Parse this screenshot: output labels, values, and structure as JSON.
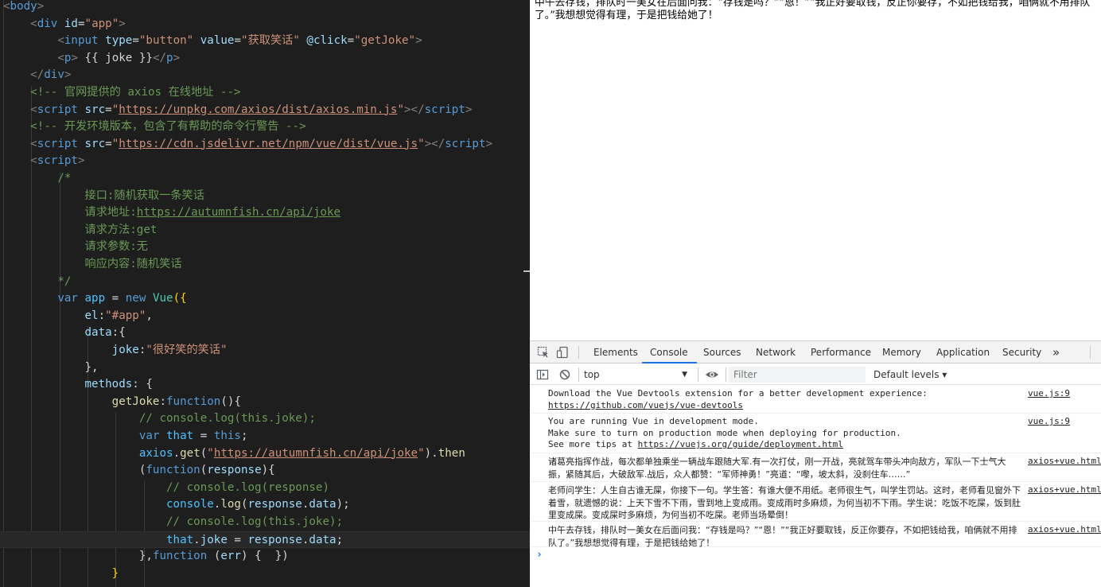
{
  "editor": {
    "lines": [
      [
        {
          "c": "br",
          "t": "<"
        },
        {
          "c": "tag",
          "t": "body"
        },
        {
          "c": "br",
          "t": ">"
        }
      ],
      [
        {
          "c": "pl",
          "t": "    "
        },
        {
          "c": "br",
          "t": "<"
        },
        {
          "c": "tag",
          "t": "div"
        },
        {
          "c": "pl",
          "t": " "
        },
        {
          "c": "attr",
          "t": "id"
        },
        {
          "c": "pl",
          "t": "="
        },
        {
          "c": "str",
          "t": "\"app\""
        },
        {
          "c": "br",
          "t": ">"
        }
      ],
      [
        {
          "c": "pl",
          "t": "        "
        },
        {
          "c": "br",
          "t": "<"
        },
        {
          "c": "tag",
          "t": "input"
        },
        {
          "c": "pl",
          "t": " "
        },
        {
          "c": "attr",
          "t": "type"
        },
        {
          "c": "pl",
          "t": "="
        },
        {
          "c": "str",
          "t": "\"button\""
        },
        {
          "c": "pl",
          "t": " "
        },
        {
          "c": "attr",
          "t": "value"
        },
        {
          "c": "pl",
          "t": "="
        },
        {
          "c": "str",
          "t": "\"获取笑话\""
        },
        {
          "c": "pl",
          "t": " "
        },
        {
          "c": "attr",
          "t": "@click"
        },
        {
          "c": "pl",
          "t": "="
        },
        {
          "c": "str",
          "t": "\"getJoke\""
        },
        {
          "c": "br",
          "t": ">"
        }
      ],
      [
        {
          "c": "pl",
          "t": "        "
        },
        {
          "c": "br",
          "t": "<"
        },
        {
          "c": "tag",
          "t": "p"
        },
        {
          "c": "br",
          "t": ">"
        },
        {
          "c": "pl",
          "t": " {{ joke }}"
        },
        {
          "c": "br",
          "t": "</"
        },
        {
          "c": "tag",
          "t": "p"
        },
        {
          "c": "br",
          "t": ">"
        }
      ],
      [
        {
          "c": "pl",
          "t": "    "
        },
        {
          "c": "br",
          "t": "</"
        },
        {
          "c": "tag",
          "t": "div"
        },
        {
          "c": "br",
          "t": ">"
        }
      ],
      [
        {
          "c": "pl",
          "t": "    "
        },
        {
          "c": "cmt",
          "t": "<!-- 官网提供的 axios 在线地址 -->"
        }
      ],
      [
        {
          "c": "pl",
          "t": "    "
        },
        {
          "c": "br",
          "t": "<"
        },
        {
          "c": "tag",
          "t": "script"
        },
        {
          "c": "pl",
          "t": " "
        },
        {
          "c": "attr",
          "t": "src"
        },
        {
          "c": "pl",
          "t": "="
        },
        {
          "c": "str",
          "t": "\""
        },
        {
          "c": "str u",
          "t": "https://unpkg.com/axios/dist/axios.min.js"
        },
        {
          "c": "str",
          "t": "\""
        },
        {
          "c": "br",
          "t": "></"
        },
        {
          "c": "tag",
          "t": "script"
        },
        {
          "c": "br",
          "t": ">"
        }
      ],
      [
        {
          "c": "pl",
          "t": "    "
        },
        {
          "c": "cmt",
          "t": "<!-- 开发环境版本，包含了有帮助的命令行警告 -->"
        }
      ],
      [
        {
          "c": "pl",
          "t": "    "
        },
        {
          "c": "br",
          "t": "<"
        },
        {
          "c": "tag",
          "t": "script"
        },
        {
          "c": "pl",
          "t": " "
        },
        {
          "c": "attr",
          "t": "src"
        },
        {
          "c": "pl",
          "t": "="
        },
        {
          "c": "str",
          "t": "\""
        },
        {
          "c": "str u",
          "t": "https://cdn.jsdelivr.net/npm/vue/dist/vue.js"
        },
        {
          "c": "str",
          "t": "\""
        },
        {
          "c": "br",
          "t": "></"
        },
        {
          "c": "tag",
          "t": "script"
        },
        {
          "c": "br",
          "t": ">"
        }
      ],
      [
        {
          "c": "pl",
          "t": "    "
        },
        {
          "c": "br",
          "t": "<"
        },
        {
          "c": "tag",
          "t": "script"
        },
        {
          "c": "br",
          "t": ">"
        }
      ],
      [
        {
          "c": "pl",
          "t": "        "
        },
        {
          "c": "cmt",
          "t": "/*"
        }
      ],
      [
        {
          "c": "pl",
          "t": "            "
        },
        {
          "c": "cmt",
          "t": "接口:随机获取一条笑话"
        }
      ],
      [
        {
          "c": "pl",
          "t": "            "
        },
        {
          "c": "cmt",
          "t": "请求地址:"
        },
        {
          "c": "cmt u",
          "t": "https://autumnfish.cn/api/joke"
        }
      ],
      [
        {
          "c": "pl",
          "t": "            "
        },
        {
          "c": "cmt",
          "t": "请求方法:get"
        }
      ],
      [
        {
          "c": "pl",
          "t": "            "
        },
        {
          "c": "cmt",
          "t": "请求参数:无"
        }
      ],
      [
        {
          "c": "pl",
          "t": "            "
        },
        {
          "c": "cmt",
          "t": "响应内容:随机笑话"
        }
      ],
      [
        {
          "c": "pl",
          "t": "        "
        },
        {
          "c": "cmt",
          "t": "*/"
        }
      ],
      [
        {
          "c": "pl",
          "t": "        "
        },
        {
          "c": "kw",
          "t": "var"
        },
        {
          "c": "pl",
          "t": " "
        },
        {
          "c": "var",
          "t": "app"
        },
        {
          "c": "pl",
          "t": " = "
        },
        {
          "c": "kw",
          "t": "new"
        },
        {
          "c": "pl",
          "t": " "
        },
        {
          "c": "cls",
          "t": "Vue"
        },
        {
          "c": "pun",
          "t": "({"
        }
      ],
      [
        {
          "c": "pl",
          "t": "            "
        },
        {
          "c": "prop",
          "t": "el"
        },
        {
          "c": "pl",
          "t": ":"
        },
        {
          "c": "str",
          "t": "\"#app\""
        },
        {
          "c": "pl",
          "t": ","
        }
      ],
      [
        {
          "c": "pl",
          "t": "            "
        },
        {
          "c": "prop",
          "t": "data"
        },
        {
          "c": "pl",
          "t": ":{"
        }
      ],
      [
        {
          "c": "pl",
          "t": "                "
        },
        {
          "c": "prop",
          "t": "joke"
        },
        {
          "c": "pl",
          "t": ":"
        },
        {
          "c": "str",
          "t": "\"很好笑的笑话\""
        }
      ],
      [
        {
          "c": "pl",
          "t": "            "
        },
        {
          "c": "pl",
          "t": "},"
        }
      ],
      [
        {
          "c": "pl",
          "t": "            "
        },
        {
          "c": "prop",
          "t": "methods"
        },
        {
          "c": "pl",
          "t": ": {"
        }
      ],
      [
        {
          "c": "pl",
          "t": "                "
        },
        {
          "c": "fn",
          "t": "getJoke"
        },
        {
          "c": "pl",
          "t": ":"
        },
        {
          "c": "kw",
          "t": "function"
        },
        {
          "c": "pl",
          "t": "(){"
        }
      ],
      [
        {
          "c": "pl",
          "t": "                    "
        },
        {
          "c": "cmt",
          "t": "// console.log(this.joke);"
        }
      ],
      [
        {
          "c": "pl",
          "t": "                    "
        },
        {
          "c": "kw",
          "t": "var"
        },
        {
          "c": "pl",
          "t": " "
        },
        {
          "c": "var",
          "t": "that"
        },
        {
          "c": "pl",
          "t": " = "
        },
        {
          "c": "kw",
          "t": "this"
        },
        {
          "c": "pl",
          "t": ";"
        }
      ],
      [
        {
          "c": "pl",
          "t": "                    "
        },
        {
          "c": "var",
          "t": "axios"
        },
        {
          "c": "pl",
          "t": "."
        },
        {
          "c": "fn",
          "t": "get"
        },
        {
          "c": "pl",
          "t": "("
        },
        {
          "c": "str",
          "t": "\""
        },
        {
          "c": "str u",
          "t": "https://autumnfish.cn/api/joke"
        },
        {
          "c": "str",
          "t": "\""
        },
        {
          "c": "pl",
          "t": ")."
        },
        {
          "c": "fn",
          "t": "then"
        }
      ],
      [
        {
          "c": "pl",
          "t": "                    "
        },
        {
          "c": "pl",
          "t": "("
        },
        {
          "c": "kw",
          "t": "function"
        },
        {
          "c": "pl",
          "t": "("
        },
        {
          "c": "prop",
          "t": "response"
        },
        {
          "c": "pl",
          "t": "){"
        }
      ],
      [
        {
          "c": "pl",
          "t": "                        "
        },
        {
          "c": "cmt",
          "t": "// console.log(response)"
        }
      ],
      [
        {
          "c": "pl",
          "t": "                        "
        },
        {
          "c": "var",
          "t": "console"
        },
        {
          "c": "pl",
          "t": "."
        },
        {
          "c": "fn",
          "t": "log"
        },
        {
          "c": "pl",
          "t": "("
        },
        {
          "c": "prop",
          "t": "response"
        },
        {
          "c": "pl",
          "t": "."
        },
        {
          "c": "prop",
          "t": "data"
        },
        {
          "c": "pl",
          "t": ");"
        }
      ],
      [
        {
          "c": "pl",
          "t": "                        "
        },
        {
          "c": "cmt",
          "t": "// console.log(this.joke);"
        }
      ],
      [
        {
          "c": "pl",
          "t": "                        "
        },
        {
          "c": "var",
          "t": "that"
        },
        {
          "c": "pl",
          "t": "."
        },
        {
          "c": "prop",
          "t": "joke"
        },
        {
          "c": "pl",
          "t": " = "
        },
        {
          "c": "prop",
          "t": "response"
        },
        {
          "c": "pl",
          "t": "."
        },
        {
          "c": "prop",
          "t": "data"
        },
        {
          "c": "pl",
          "t": ";"
        }
      ],
      [
        {
          "c": "pl",
          "t": "                    "
        },
        {
          "c": "pl",
          "t": "},"
        },
        {
          "c": "kw",
          "t": "function"
        },
        {
          "c": "pl",
          "t": " ("
        },
        {
          "c": "prop",
          "t": "err"
        },
        {
          "c": "pl",
          "t": ") {  })"
        }
      ],
      [
        {
          "c": "pl",
          "t": "                "
        },
        {
          "c": "pun",
          "t": "}"
        }
      ]
    ]
  },
  "page": {
    "joke_text": "中午去存钱，排队时一美女在后面问我：“存钱是吗？”“恩！”“我正好要取钱，反正你要存，不如把钱给我，咱俩就不用排队了。”我想想觉得有理，于是把钱给她了！"
  },
  "devtools": {
    "tabs": [
      "Elements",
      "Console",
      "Sources",
      "Network",
      "Performance",
      "Memory",
      "Application",
      "Security"
    ],
    "active_tab": "Console",
    "more_tabs": "»",
    "context": "top",
    "filter_placeholder": "Filter",
    "levels": "Default levels ▾",
    "messages": [
      {
        "text": "Download the Vue Devtools extension for a better development experience:",
        "link": "https://github.com/vuejs/vue-devtools",
        "source": "vue.js:9"
      },
      {
        "text": "You are running Vue in development mode.\nMake sure to turn on production mode when deploying for production.\nSee more tips at ",
        "link": "https://vuejs.org/guide/deployment.html",
        "source": "vue.js:9"
      },
      {
        "text": "诸葛亮指挥作战，每次都单独乘坐一辆战车跟随大军.有一次打仗，刚一开战，亮就驾车带头冲向敌方，军队一下士气大振，紧随其后，大破敌军.战后，众人都赞：“军师神勇！”亮道：“嚟，坡太斜，没刹住车……”",
        "source": "axios+vue.html"
      },
      {
        "text": "老师问学生：人生自古谁无屎，你接下一句。学生答：有谁大便不用纸。老师很生气，叫学生罚站。这时，老师看见窗外下着雪，就遗憾的说：上天下雪不下雨，雪到地上变成雨。变成雨时多麻烦，为何当初不下雨。学生说：吃饭不吃屎，饭到肚里变成屎。变成屎时多麻烦，为何当初不吃屎。老师当场晕倒！",
        "source": "axios+vue.html"
      },
      {
        "text": "中午去存钱，排队时一美女在后面问我：“存钱是吗？”“恩！”“我正好要取钱，反正你要存，不如把钱给我，咱俩就不用排队了。”我想想觉得有理，于是把钱给她了！",
        "source": "axios+vue.html"
      }
    ],
    "prompt": "›"
  }
}
